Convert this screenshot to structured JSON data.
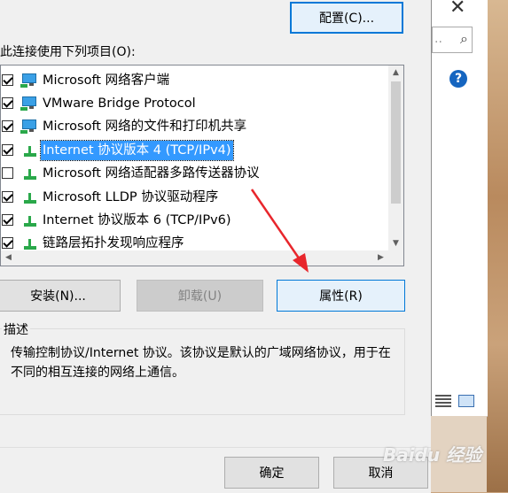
{
  "dialog": {
    "configure_label": "配置(C)...",
    "connection_uses_label": "此连接使用下列项目(O):",
    "items": [
      {
        "label": "Microsoft 网络客户端",
        "checked": true,
        "icon": "monitor-icon"
      },
      {
        "label": "VMware Bridge Protocol",
        "checked": true,
        "icon": "monitor-icon"
      },
      {
        "label": "Microsoft 网络的文件和打印机共享",
        "checked": true,
        "icon": "monitor-icon"
      },
      {
        "label": "Internet 协议版本 4 (TCP/IPv4)",
        "checked": true,
        "icon": "network-protocol-icon",
        "selected": true
      },
      {
        "label": "Microsoft 网络适配器多路传送器协议",
        "checked": false,
        "icon": "network-protocol-icon"
      },
      {
        "label": "Microsoft LLDP 协议驱动程序",
        "checked": true,
        "icon": "network-protocol-icon"
      },
      {
        "label": "Internet 协议版本 6 (TCP/IPv6)",
        "checked": true,
        "icon": "network-protocol-icon"
      },
      {
        "label": "链路层拓扑发现响应程序",
        "checked": true,
        "icon": "network-protocol-icon"
      }
    ],
    "install_label": "安装(N)...",
    "uninstall_label": "卸载(U)",
    "properties_label": "属性(R)",
    "description_title": "描述",
    "description_text": "传输控制协议/Internet 协议。该协议是默认的广域网络协议，用于在不同的相互连接的网络上通信。",
    "ok_label": "确定",
    "cancel_label": "取消"
  },
  "background_window": {
    "close_glyph": "✕",
    "help_glyph": "?"
  },
  "watermark": "Baidu 经验",
  "colors": {
    "selection": "#3399ff",
    "focus_border": "#0078d7",
    "arrow": "#e8262c"
  }
}
